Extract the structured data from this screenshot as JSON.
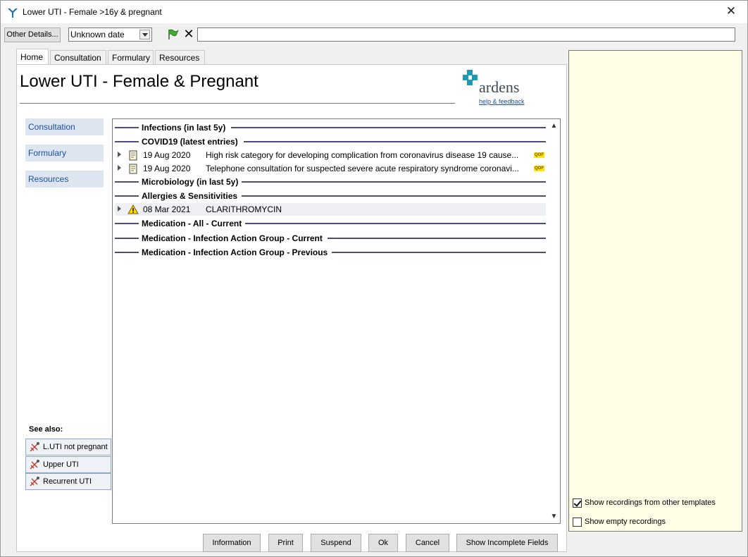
{
  "window": {
    "title": "Lower UTI - Female >16y & pregnant",
    "close_glyph": "✕"
  },
  "toolbar": {
    "other_details_label": "Other Details...",
    "date_value": "Unknown date",
    "search_value": ""
  },
  "tabs": [
    {
      "label": "Home",
      "active": true
    },
    {
      "label": "Consultation",
      "active": false
    },
    {
      "label": "Formulary",
      "active": false
    },
    {
      "label": "Resources",
      "active": false
    }
  ],
  "page": {
    "title": "Lower UTI - Female & Pregnant",
    "logo_text": "ardens",
    "help_link": "help & feedback"
  },
  "sidenav": [
    {
      "label": "Consultation"
    },
    {
      "label": "Formulary"
    },
    {
      "label": "Resources"
    }
  ],
  "see_also": {
    "label": "See also:",
    "items": [
      {
        "label": "L.UTI not pregnant"
      },
      {
        "label": "Upper UTI"
      },
      {
        "label": "Recurrent UTI"
      }
    ]
  },
  "list": {
    "sections": [
      {
        "label": "Infections (in last 5y)"
      },
      {
        "label": "COVID19 (latest entries)"
      },
      {
        "label": "Microbiology (in last 5y)"
      },
      {
        "label": "Allergies & Sensitivities"
      },
      {
        "label": "Medication - All - Current"
      },
      {
        "label": "Medication - Infection Action Group - Current"
      },
      {
        "label": "Medication - Infection Action Group - Previous"
      }
    ],
    "covid_rows": [
      {
        "date": "19 Aug 2020",
        "desc": "High risk category for developing complication from coronavirus disease 19 cause...",
        "badge": "QOF"
      },
      {
        "date": "19 Aug 2020",
        "desc": "Telephone consultation for suspected severe acute respiratory syndrome coronavi...",
        "badge": "QOF"
      }
    ],
    "allergy_rows": [
      {
        "date": "08 Mar 2021",
        "desc": "CLARITHROMYCIN"
      }
    ]
  },
  "right_panel": {
    "show_other_templates": {
      "label": "Show recordings from other templates",
      "checked": true
    },
    "show_empty": {
      "label": "Show empty recordings",
      "checked": false
    }
  },
  "buttons": {
    "information": "Information",
    "print": "Print",
    "suspend": "Suspend",
    "ok": "Ok",
    "cancel": "Cancel",
    "show_incomplete": "Show Incomplete Fields"
  },
  "colors": {
    "accent_teal": "#1f9ab4",
    "link_blue": "#1a4e9c",
    "right_panel_bg": "#fffee6",
    "qof_badge": "#ffe800"
  }
}
